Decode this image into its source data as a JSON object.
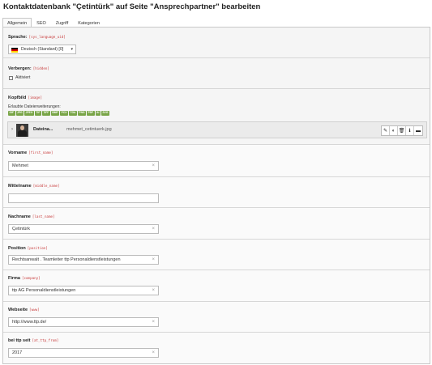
{
  "header": {
    "title": "Kontaktdatenbank \"Çetintürk\" auf Seite \"Ansprechpartner\" bearbeiten"
  },
  "tabs": [
    {
      "label": "Allgemein",
      "active": true
    },
    {
      "label": "SEO",
      "active": false
    },
    {
      "label": "Zugriff",
      "active": false
    },
    {
      "label": "Kategorien",
      "active": false
    }
  ],
  "language": {
    "label": "Sprache:",
    "field": "[sys_language_uid]",
    "value": "Deutsch (Standard) [0]"
  },
  "hidden": {
    "label": "Verbergen:",
    "field": "[hidden]",
    "checkbox_label": "Aktiviert",
    "checked": false
  },
  "image": {
    "label": "Kopfbild",
    "field": "[image]",
    "allowed_label": "Erlaubte Dateierweiterungen:",
    "extensions": [
      "GIF",
      "JPG",
      "JPEG",
      "TIF",
      "TIFF",
      "BMP",
      "PCX",
      "TGA",
      "PNG",
      "PDF",
      "AI",
      "SVG"
    ],
    "file_title": "Dateina...",
    "file_name": "mehmet_cetintuerk.jpg",
    "chevron": "›"
  },
  "fields": [
    {
      "label": "Vorname",
      "field": "[first_name]",
      "value": "Mehmet"
    },
    {
      "label": "Mittelname",
      "field": "[middle_name]",
      "value": ""
    },
    {
      "label": "Nachname",
      "field": "[last_name]",
      "value": "Çetintürk"
    },
    {
      "label": "Position",
      "field": "[position]",
      "value": "Rechtsanwalt . Teamleiter ttp Personaldienstleistungen"
    },
    {
      "label": "Firma",
      "field": "[company]",
      "value": "ttp AG Personaldienstleistungen"
    },
    {
      "label": "Webseite",
      "field": "[www]",
      "value": "http://www.ttp.de/"
    },
    {
      "label": "bei ttp seit",
      "field": "[at_ttp_from]",
      "value": "2017"
    }
  ],
  "icons": {
    "clear": "×",
    "select_arrow": "▾",
    "file_actions": [
      "✎",
      "◐",
      "🗑",
      "ℹ",
      "▬"
    ]
  },
  "colors": {
    "required_field": "#c83c3c",
    "extension_badge": "#79a548",
    "flag": [
      "#000000",
      "#dd0000",
      "#ffce00"
    ]
  }
}
